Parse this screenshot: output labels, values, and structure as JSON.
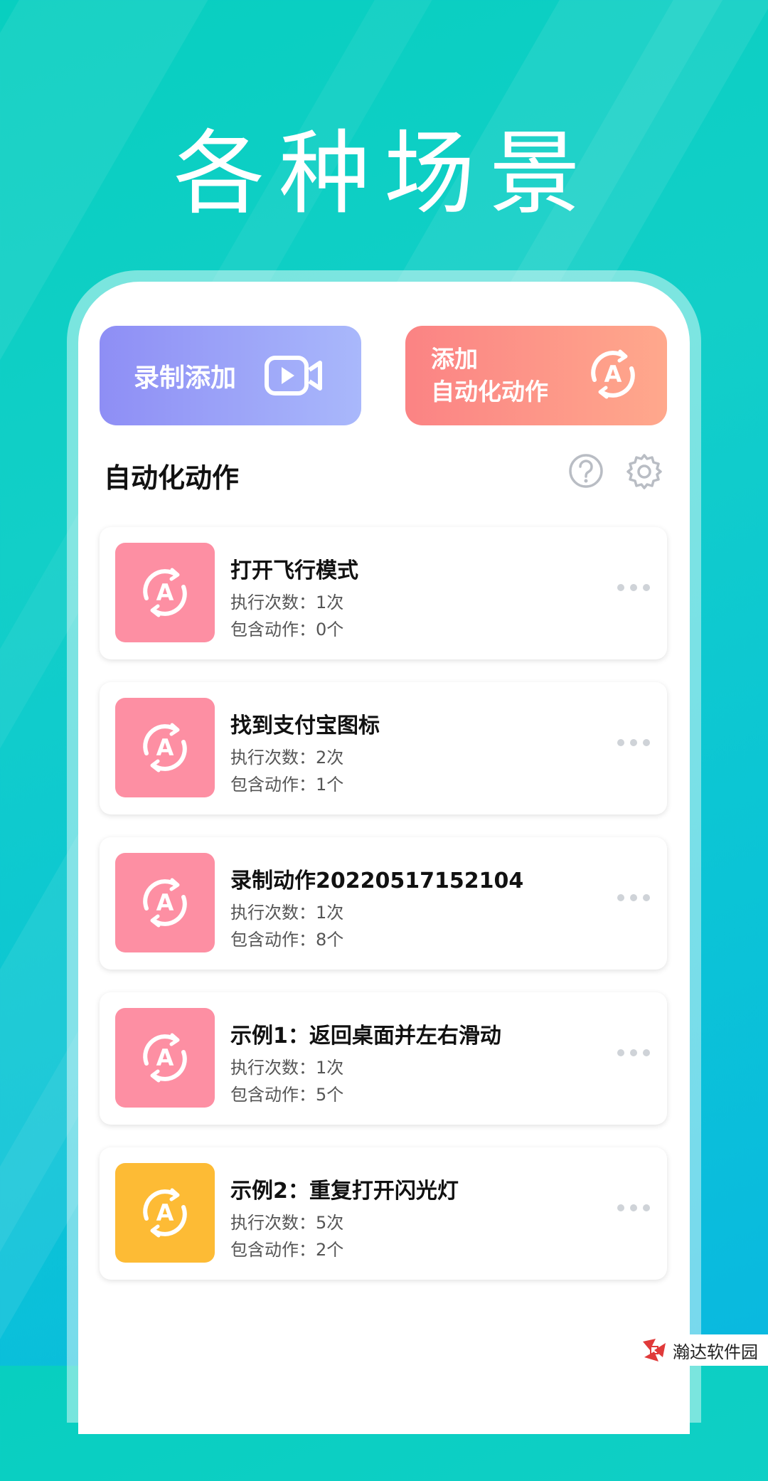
{
  "headline": "各种场景",
  "buttons": {
    "record": "录制添加",
    "add_line1": "添加",
    "add_line2": "自动化动作"
  },
  "section_title": "自动化动作",
  "colors": {
    "pink": "#fd8fa3",
    "yellow": "#fdbb35"
  },
  "cards": [
    {
      "name": "打开飞行模式",
      "runs": "执行次数：1次",
      "actions": "包含动作：0个"
    },
    {
      "name": "找到支付宝图标",
      "runs": "执行次数：2次",
      "actions": "包含动作：1个"
    },
    {
      "name": "录制动作20220517152104",
      "runs": "执行次数：1次",
      "actions": "包含动作：8个"
    },
    {
      "name": "示例1：返回桌面并左右滑动",
      "runs": "执行次数：1次",
      "actions": "包含动作：5个"
    },
    {
      "name": "示例2：重复打开闪光灯",
      "runs": "执行次数：5次",
      "actions": "包含动作：2个"
    }
  ],
  "watermark": "瀚达软件园"
}
